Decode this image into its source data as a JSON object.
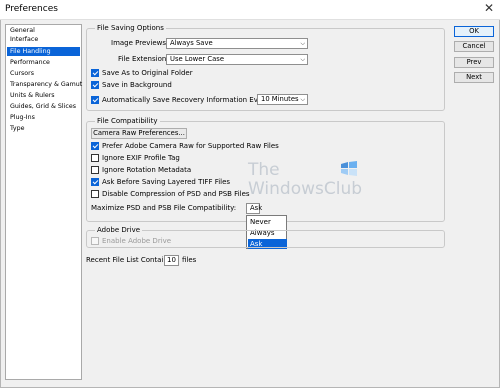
{
  "window": {
    "title": "Preferences",
    "close_glyph": "✕"
  },
  "sidebar": {
    "items": [
      {
        "label": "General"
      },
      {
        "label": "Interface"
      },
      {
        "label": "File Handling"
      },
      {
        "label": "Performance"
      },
      {
        "label": "Cursors"
      },
      {
        "label": "Transparency & Gamut"
      },
      {
        "label": "Units & Rulers"
      },
      {
        "label": "Guides, Grid & Slices"
      },
      {
        "label": "Plug-Ins"
      },
      {
        "label": "Type"
      }
    ],
    "active_index": 2
  },
  "file_saving": {
    "group_title": "File Saving Options",
    "image_previews_label": "Image Previews:",
    "image_previews_value": "Always Save",
    "file_extension_label": "File Extension:",
    "file_extension_value": "Use Lower Case",
    "save_as_original": {
      "label": "Save As to Original Folder",
      "checked": true
    },
    "save_background": {
      "label": "Save in Background",
      "checked": true
    },
    "auto_recovery": {
      "label": "Automatically Save Recovery Information Every:",
      "checked": true
    },
    "recovery_interval": "10 Minutes"
  },
  "file_compat": {
    "group_title": "File Compatibility",
    "camera_raw_button": "Camera Raw Preferences...",
    "options": [
      {
        "label": "Prefer Adobe Camera Raw for Supported Raw Files",
        "checked": true
      },
      {
        "label": "Ignore EXIF Profile Tag",
        "checked": false
      },
      {
        "label": "Ignore Rotation Metadata",
        "checked": false
      },
      {
        "label": "Ask Before Saving Layered TIFF Files",
        "checked": true
      },
      {
        "label": "Disable Compression of PSD and PSB Files",
        "checked": false
      }
    ],
    "maximize_label": "Maximize PSD and PSB File Compatibility:",
    "maximize_value": "Ask",
    "maximize_options": [
      "Never",
      "Always",
      "Ask"
    ],
    "maximize_selected_index": 2
  },
  "adobe_drive": {
    "group_title": "Adobe Drive",
    "enable_label": "Enable Adobe Drive",
    "enabled": false
  },
  "recent_files": {
    "label": "Recent File List Contains:",
    "value": "10",
    "suffix": "files"
  },
  "buttons": {
    "ok": "OK",
    "cancel": "Cancel",
    "prev": "Prev",
    "next": "Next"
  },
  "watermark": {
    "line1": "The",
    "line2": "WindowsClub"
  },
  "colors": {
    "accent": "#0a64d8",
    "background": "#f0f0f0"
  }
}
